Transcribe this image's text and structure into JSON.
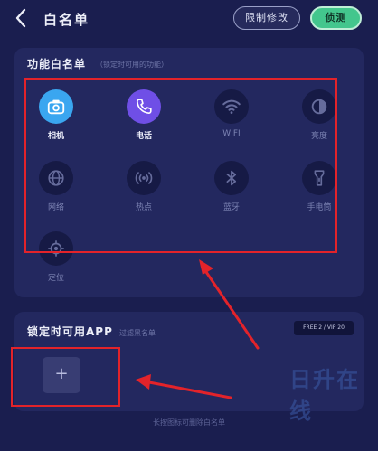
{
  "header": {
    "title": "白名单",
    "limit_button": "限制修改",
    "test_button": "侦测"
  },
  "function_whitelist": {
    "title": "功能白名单",
    "subtitle": "（锁定时可用的功能）",
    "items": [
      {
        "label": "相机",
        "icon": "camera-icon",
        "enabled": true
      },
      {
        "label": "电话",
        "icon": "phone-icon",
        "enabled": true
      },
      {
        "label": "WIFI",
        "icon": "wifi-icon",
        "enabled": false
      },
      {
        "label": "亮度",
        "icon": "brightness-icon",
        "enabled": false
      },
      {
        "label": "网络",
        "icon": "globe-icon",
        "enabled": false
      },
      {
        "label": "热点",
        "icon": "hotspot-icon",
        "enabled": false
      },
      {
        "label": "蓝牙",
        "icon": "bluetooth-icon",
        "enabled": false
      },
      {
        "label": "手电筒",
        "icon": "flashlight-icon",
        "enabled": false
      },
      {
        "label": "定位",
        "icon": "location-icon",
        "enabled": false
      }
    ]
  },
  "app_whitelist": {
    "title": "锁定时可用APP",
    "subtitle": "过滤黑名单",
    "quota": "FREE 2 / VIP 20",
    "add_label": "+"
  },
  "footer": {
    "hint": "长按图标可删除白名单"
  },
  "watermark": "日升在线",
  "colors": {
    "background": "#1a1e4f",
    "panel": "#23285f",
    "accent_green": "#43c68d",
    "camera_blue": "#3aa6f0",
    "phone_purple": "#6f4fe6",
    "annotation_red": "#e3232a"
  }
}
